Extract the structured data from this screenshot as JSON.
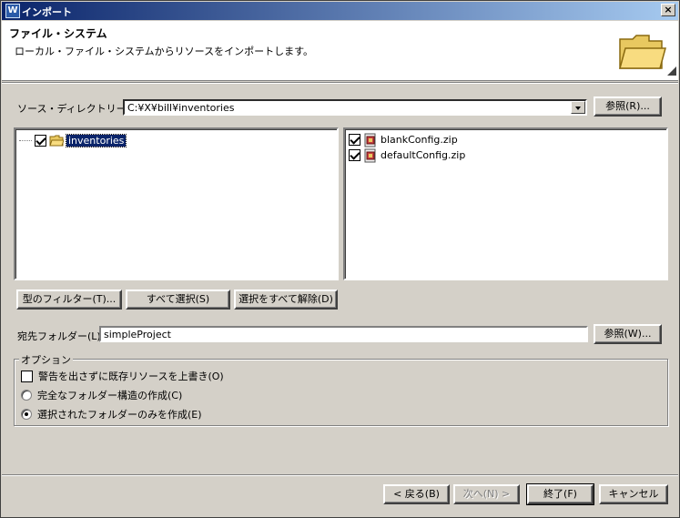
{
  "window": {
    "title": "インポート",
    "title_icon": "W",
    "close_label": "×"
  },
  "header": {
    "title": "ファイル・システム",
    "description": "ローカル・ファイル・システムからリソースをインポートします。"
  },
  "source": {
    "label": "ソース・ディレクトリー(Y):",
    "value": "C:¥X¥bill¥inventories",
    "browse_label": "参照(R)..."
  },
  "tree": {
    "items": [
      {
        "label": "inventories",
        "checked": true,
        "selected": true
      }
    ]
  },
  "files": {
    "items": [
      {
        "label": "blankConfig.zip",
        "checked": true
      },
      {
        "label": "defaultConfig.zip",
        "checked": true
      }
    ]
  },
  "selection_buttons": {
    "filter_types": "型のフィルター(T)...",
    "select_all": "すべて選択(S)",
    "deselect_all": "選択をすべて解除(D)"
  },
  "destination": {
    "label": "宛先フォルダー(L):",
    "value": "simpleProject",
    "browse_label": "参照(W)..."
  },
  "options": {
    "group_label": "オプション",
    "overwrite": {
      "label": "警告を出さずに既存リソースを上書き(O)",
      "checked": false
    },
    "create_structure": {
      "label": "完全なフォルダー構造の作成(C)",
      "selected": false
    },
    "create_selected": {
      "label": "選択されたフォルダーのみを作成(E)",
      "selected": true
    }
  },
  "footer": {
    "back": "< 戻る(B)",
    "next": "次へ(N) >",
    "finish": "終了(F)",
    "cancel": "キャンセル"
  }
}
